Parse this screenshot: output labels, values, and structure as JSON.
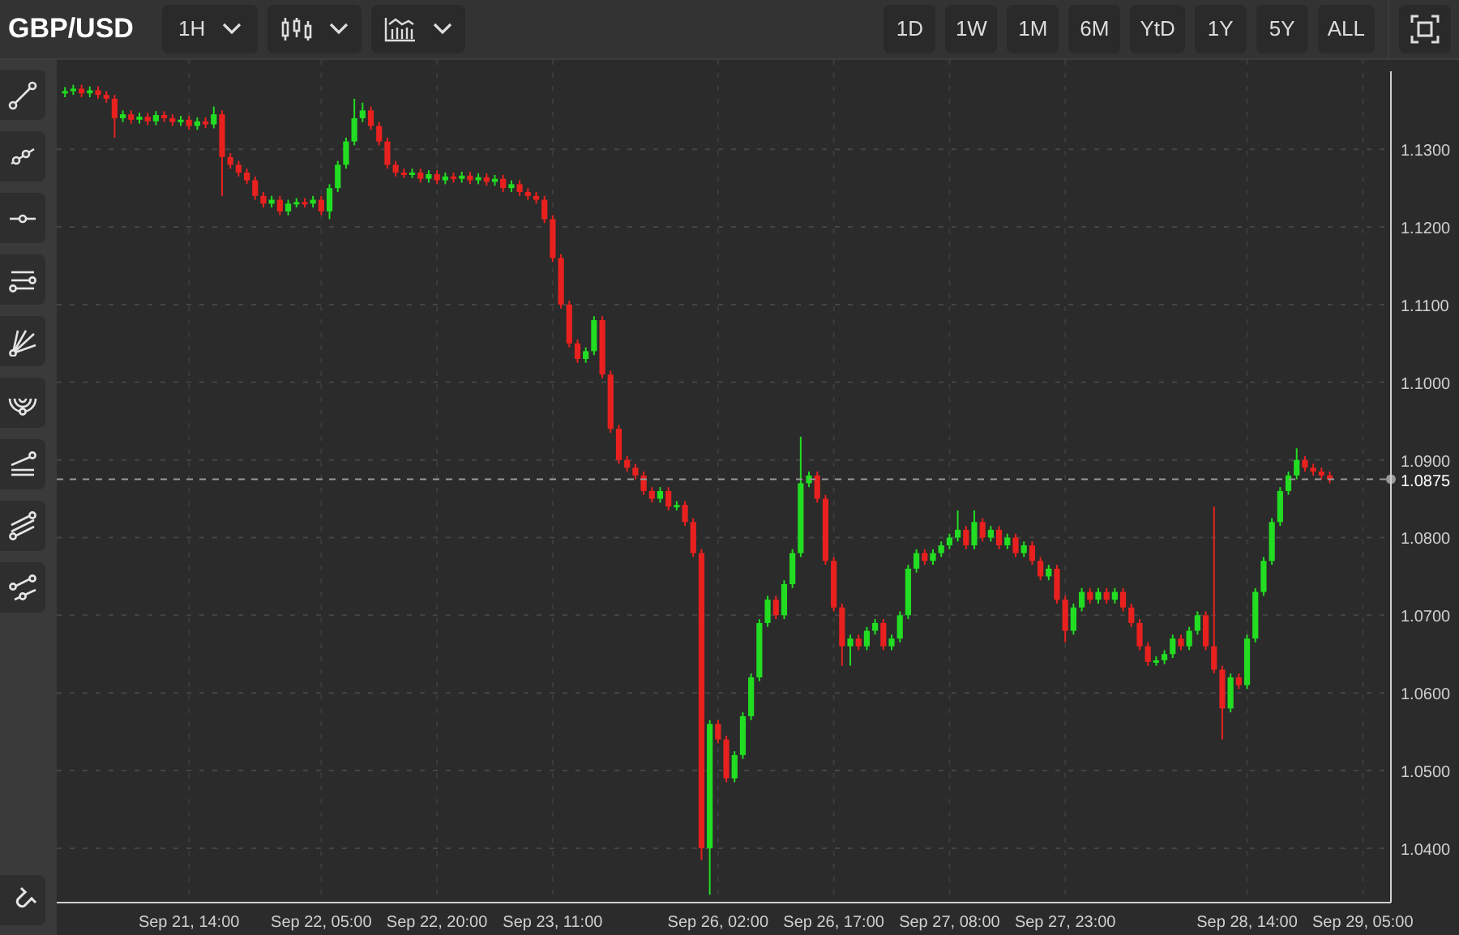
{
  "symbol": "GBP/USD",
  "toolbar": {
    "interval": "1H"
  },
  "ranges": [
    {
      "label": "1D",
      "selected": false
    },
    {
      "label": "1W",
      "selected": false
    },
    {
      "label": "1M",
      "selected": false
    },
    {
      "label": "6M",
      "selected": false
    },
    {
      "label": "YtD",
      "selected": false
    },
    {
      "label": "1Y",
      "selected": false
    },
    {
      "label": "5Y",
      "selected": false
    },
    {
      "label": "ALL",
      "selected": false
    }
  ],
  "chart_data": {
    "type": "candlestick",
    "grid": true,
    "categories": [
      null,
      null,
      null,
      null,
      null,
      null,
      null,
      null,
      null,
      null,
      null,
      null,
      null,
      null,
      null,
      "Sep 21, 14:00",
      null,
      null,
      null,
      null,
      null,
      null,
      null,
      null,
      null,
      null,
      null,
      null,
      null,
      null,
      null,
      "Sep 22, 05:00",
      null,
      null,
      null,
      null,
      null,
      null,
      null,
      null,
      null,
      null,
      null,
      null,
      null,
      "Sep 22, 20:00",
      null,
      null,
      null,
      null,
      null,
      null,
      null,
      null,
      null,
      null,
      null,
      null,
      null,
      "Sep 23, 11:00",
      null,
      null,
      null,
      null,
      null,
      null,
      null,
      null,
      null,
      null,
      null,
      null,
      null,
      null,
      null,
      null,
      null,
      null,
      null,
      "Sep 26, 02:00",
      null,
      null,
      null,
      null,
      null,
      null,
      null,
      null,
      null,
      null,
      null,
      null,
      null,
      "Sep 26, 17:00",
      null,
      null,
      null,
      null,
      null,
      null,
      null,
      null,
      null,
      null,
      null,
      null,
      null,
      "Sep 27, 08:00",
      null,
      null,
      null,
      null,
      null,
      null,
      null,
      null,
      null,
      null,
      null,
      null,
      null,
      "Sep 27, 23:00",
      null,
      null,
      null,
      null,
      null,
      null,
      null,
      null,
      null,
      null,
      null,
      null,
      null,
      null,
      null,
      null,
      null,
      null,
      null,
      null,
      null,
      "Sep 28, 14:00",
      null,
      null,
      null,
      null,
      null,
      null,
      null,
      null,
      null,
      null,
      null,
      null,
      null,
      "Sep 29, 05:00",
      null,
      null,
      null
    ],
    "ohlc": [
      [
        1.1372,
        1.138,
        1.1367,
        1.1375
      ],
      [
        1.1375,
        1.1383,
        1.137,
        1.1378
      ],
      [
        1.1378,
        1.1383,
        1.1367,
        1.1372
      ],
      [
        1.1372,
        1.1381,
        1.1367,
        1.1376
      ],
      [
        1.1376,
        1.1381,
        1.1365,
        1.137
      ],
      [
        1.137,
        1.1375,
        1.136,
        1.1365
      ],
      [
        1.1365,
        1.137,
        1.1315,
        1.134
      ],
      [
        1.134,
        1.135,
        1.1335,
        1.1345
      ],
      [
        1.1345,
        1.135,
        1.1333,
        1.1338
      ],
      [
        1.1338,
        1.1347,
        1.1333,
        1.1342
      ],
      [
        1.1342,
        1.1347,
        1.1331,
        1.1336
      ],
      [
        1.1336,
        1.1349,
        1.1331,
        1.1344
      ],
      [
        1.1344,
        1.1349,
        1.1335,
        1.134
      ],
      [
        1.134,
        1.1345,
        1.133,
        1.1335
      ],
      [
        1.1335,
        1.1343,
        1.133,
        1.1338
      ],
      [
        1.1338,
        1.1343,
        1.1325,
        1.133
      ],
      [
        1.133,
        1.1341,
        1.1325,
        1.1336
      ],
      [
        1.1336,
        1.1341,
        1.1327,
        1.1332
      ],
      [
        1.1332,
        1.1355,
        1.1327,
        1.1345
      ],
      [
        1.1345,
        1.135,
        1.124,
        1.129
      ],
      [
        1.129,
        1.1295,
        1.1275,
        1.128
      ],
      [
        1.128,
        1.1285,
        1.1265,
        1.127
      ],
      [
        1.127,
        1.1275,
        1.1255,
        1.126
      ],
      [
        1.126,
        1.1265,
        1.1235,
        1.124
      ],
      [
        1.124,
        1.1245,
        1.1225,
        1.123
      ],
      [
        1.123,
        1.124,
        1.1225,
        1.1235
      ],
      [
        1.1235,
        1.124,
        1.1215,
        1.122
      ],
      [
        1.122,
        1.1235,
        1.1215,
        1.123
      ],
      [
        1.123,
        1.1237,
        1.1225,
        1.1232
      ],
      [
        1.1232,
        1.1237,
        1.1225,
        1.123
      ],
      [
        1.123,
        1.124,
        1.1225,
        1.1235
      ],
      [
        1.1235,
        1.124,
        1.1215,
        1.122
      ],
      [
        1.122,
        1.1255,
        1.121,
        1.125
      ],
      [
        1.125,
        1.1285,
        1.1245,
        1.128
      ],
      [
        1.128,
        1.1315,
        1.1275,
        1.131
      ],
      [
        1.131,
        1.1365,
        1.1305,
        1.134
      ],
      [
        1.134,
        1.136,
        1.1335,
        1.135
      ],
      [
        1.135,
        1.1355,
        1.1325,
        1.133
      ],
      [
        1.133,
        1.1335,
        1.1305,
        1.131
      ],
      [
        1.131,
        1.1315,
        1.1275,
        1.128
      ],
      [
        1.128,
        1.1285,
        1.1265,
        1.127
      ],
      [
        1.127,
        1.1275,
        1.1263,
        1.1268
      ],
      [
        1.1268,
        1.1275,
        1.1263,
        1.127
      ],
      [
        1.127,
        1.1275,
        1.1257,
        1.1262
      ],
      [
        1.1262,
        1.1273,
        1.1257,
        1.1268
      ],
      [
        1.1268,
        1.1273,
        1.1255,
        1.126
      ],
      [
        1.126,
        1.127,
        1.1255,
        1.1265
      ],
      [
        1.1265,
        1.127,
        1.1257,
        1.1262
      ],
      [
        1.1262,
        1.1271,
        1.1257,
        1.1266
      ],
      [
        1.1266,
        1.1271,
        1.1255,
        1.126
      ],
      [
        1.126,
        1.1269,
        1.1255,
        1.1264
      ],
      [
        1.1264,
        1.1269,
        1.1253,
        1.1258
      ],
      [
        1.1258,
        1.1267,
        1.1253,
        1.1262
      ],
      [
        1.1262,
        1.1267,
        1.1245,
        1.125
      ],
      [
        1.125,
        1.126,
        1.1245,
        1.1255
      ],
      [
        1.1255,
        1.126,
        1.124,
        1.1245
      ],
      [
        1.1245,
        1.125,
        1.1235,
        1.124
      ],
      [
        1.124,
        1.1245,
        1.123,
        1.1235
      ],
      [
        1.1235,
        1.124,
        1.1205,
        1.121
      ],
      [
        1.121,
        1.1215,
        1.1155,
        1.116
      ],
      [
        1.116,
        1.1165,
        1.1095,
        1.11
      ],
      [
        1.11,
        1.1105,
        1.1045,
        1.105
      ],
      [
        1.105,
        1.1055,
        1.1025,
        1.103
      ],
      [
        1.103,
        1.1045,
        1.1025,
        1.104
      ],
      [
        1.104,
        1.1085,
        1.1035,
        1.108
      ],
      [
        1.108,
        1.1085,
        1.1005,
        1.101
      ],
      [
        1.101,
        1.1015,
        1.0935,
        1.094
      ],
      [
        1.094,
        1.0945,
        1.0895,
        1.09
      ],
      [
        1.09,
        1.0905,
        1.0885,
        1.089
      ],
      [
        1.089,
        1.0895,
        1.0875,
        1.088
      ],
      [
        1.088,
        1.0885,
        1.0855,
        1.086
      ],
      [
        1.086,
        1.0865,
        1.0845,
        1.085
      ],
      [
        1.085,
        1.0865,
        1.0845,
        1.086
      ],
      [
        1.086,
        1.0865,
        1.0835,
        1.084
      ],
      [
        1.084,
        1.0847,
        1.0835,
        1.0842
      ],
      [
        1.0842,
        1.0847,
        1.0815,
        1.082
      ],
      [
        1.082,
        1.0825,
        1.0775,
        1.078
      ],
      [
        1.078,
        1.0785,
        1.0385,
        1.04
      ],
      [
        1.04,
        1.0565,
        1.034,
        1.056
      ],
      [
        1.056,
        1.0565,
        1.0535,
        1.054
      ],
      [
        1.054,
        1.0545,
        1.0485,
        1.049
      ],
      [
        1.049,
        1.0525,
        1.0485,
        1.052
      ],
      [
        1.052,
        1.0575,
        1.0515,
        1.057
      ],
      [
        1.057,
        1.0625,
        1.0565,
        1.062
      ],
      [
        1.062,
        1.0695,
        1.0615,
        1.069
      ],
      [
        1.069,
        1.0725,
        1.0685,
        1.072
      ],
      [
        1.072,
        1.0725,
        1.0695,
        1.07
      ],
      [
        1.07,
        1.0745,
        1.0695,
        1.074
      ],
      [
        1.074,
        1.0785,
        1.0735,
        1.078
      ],
      [
        1.078,
        1.093,
        1.0775,
        1.087
      ],
      [
        1.087,
        1.0885,
        1.0865,
        1.088
      ],
      [
        1.088,
        1.0885,
        1.0845,
        1.085
      ],
      [
        1.085,
        1.0855,
        1.0765,
        1.077
      ],
      [
        1.077,
        1.0775,
        1.0705,
        1.071
      ],
      [
        1.071,
        1.0715,
        1.0635,
        1.066
      ],
      [
        1.066,
        1.0675,
        1.0635,
        1.067
      ],
      [
        1.067,
        1.0675,
        1.0655,
        1.066
      ],
      [
        1.066,
        1.0685,
        1.0655,
        1.068
      ],
      [
        1.068,
        1.0695,
        1.0675,
        1.069
      ],
      [
        1.069,
        1.0695,
        1.0655,
        1.066
      ],
      [
        1.066,
        1.0675,
        1.0655,
        1.067
      ],
      [
        1.067,
        1.0705,
        1.0665,
        1.07
      ],
      [
        1.07,
        1.0765,
        1.0695,
        1.076
      ],
      [
        1.076,
        1.0785,
        1.0755,
        1.078
      ],
      [
        1.078,
        1.0785,
        1.0765,
        1.077
      ],
      [
        1.077,
        1.0785,
        1.0765,
        1.078
      ],
      [
        1.078,
        1.0795,
        1.0775,
        1.079
      ],
      [
        1.079,
        1.0805,
        1.0785,
        1.08
      ],
      [
        1.08,
        1.0835,
        1.0795,
        1.081
      ],
      [
        1.081,
        1.0815,
        1.0785,
        1.079
      ],
      [
        1.079,
        1.0835,
        1.0785,
        1.082
      ],
      [
        1.082,
        1.0825,
        1.0795,
        1.08
      ],
      [
        1.08,
        1.0815,
        1.0795,
        1.081
      ],
      [
        1.081,
        1.0815,
        1.0785,
        1.079
      ],
      [
        1.079,
        1.0805,
        1.0785,
        1.08
      ],
      [
        1.08,
        1.0805,
        1.0775,
        1.078
      ],
      [
        1.078,
        1.0795,
        1.0775,
        1.079
      ],
      [
        1.079,
        1.0795,
        1.0765,
        1.077
      ],
      [
        1.077,
        1.0775,
        1.0745,
        1.075
      ],
      [
        1.075,
        1.0765,
        1.0745,
        1.076
      ],
      [
        1.076,
        1.0765,
        1.0715,
        1.072
      ],
      [
        1.072,
        1.0725,
        1.0665,
        1.068
      ],
      [
        1.068,
        1.0715,
        1.0675,
        1.071
      ],
      [
        1.071,
        1.0735,
        1.0705,
        1.073
      ],
      [
        1.073,
        1.0735,
        1.0715,
        1.072
      ],
      [
        1.072,
        1.0735,
        1.0715,
        1.073
      ],
      [
        1.073,
        1.0735,
        1.0715,
        1.072
      ],
      [
        1.072,
        1.0735,
        1.0715,
        1.073
      ],
      [
        1.073,
        1.0735,
        1.0705,
        1.071
      ],
      [
        1.071,
        1.0715,
        1.0685,
        1.069
      ],
      [
        1.069,
        1.0695,
        1.0655,
        1.066
      ],
      [
        1.066,
        1.0665,
        1.0635,
        1.064
      ],
      [
        1.064,
        1.0647,
        1.0635,
        1.0642
      ],
      [
        1.0642,
        1.0655,
        1.0637,
        1.065
      ],
      [
        1.065,
        1.0675,
        1.0645,
        1.067
      ],
      [
        1.067,
        1.0675,
        1.0655,
        1.066
      ],
      [
        1.066,
        1.0685,
        1.0655,
        1.068
      ],
      [
        1.068,
        1.0705,
        1.0675,
        1.07
      ],
      [
        1.07,
        1.0705,
        1.0655,
        1.066
      ],
      [
        1.066,
        1.084,
        1.0625,
        1.063
      ],
      [
        1.063,
        1.0635,
        1.054,
        1.058
      ],
      [
        1.058,
        1.0625,
        1.0575,
        1.062
      ],
      [
        1.062,
        1.0625,
        1.0605,
        1.061
      ],
      [
        1.061,
        1.0675,
        1.0605,
        1.067
      ],
      [
        1.067,
        1.0735,
        1.0665,
        1.073
      ],
      [
        1.073,
        1.0775,
        1.0725,
        1.077
      ],
      [
        1.077,
        1.0825,
        1.0765,
        1.082
      ],
      [
        1.082,
        1.0865,
        1.0815,
        1.086
      ],
      [
        1.086,
        1.0885,
        1.0855,
        1.088
      ],
      [
        1.088,
        1.0915,
        1.0875,
        1.09
      ],
      [
        1.09,
        1.0905,
        1.0885,
        1.089
      ],
      [
        1.089,
        1.0895,
        1.088,
        1.0885
      ],
      [
        1.0885,
        1.089,
        1.0875,
        1.088
      ],
      [
        1.088,
        1.0885,
        1.087,
        1.0875
      ],
      null,
      null,
      null,
      null,
      null,
      null,
      null
    ],
    "ylim": [
      1.033,
      1.1415
    ],
    "yticks": [
      {
        "value": 1.13,
        "label": "1.1300"
      },
      {
        "value": 1.12,
        "label": "1.1200"
      },
      {
        "value": 1.11,
        "label": "1.1100"
      },
      {
        "value": 1.1,
        "label": "1.1000"
      },
      {
        "value": 1.09,
        "label": "1.0900"
      },
      {
        "value": 1.08,
        "label": "1.0800"
      },
      {
        "value": 1.07,
        "label": "1.0700"
      },
      {
        "value": 1.06,
        "label": "1.0600"
      },
      {
        "value": 1.05,
        "label": "1.0500"
      },
      {
        "value": 1.04,
        "label": "1.0400"
      }
    ],
    "ref_lines": [
      {
        "axis": "y",
        "value": 1.0875,
        "label": "1.0875",
        "color": "#9a9a9a"
      }
    ]
  }
}
